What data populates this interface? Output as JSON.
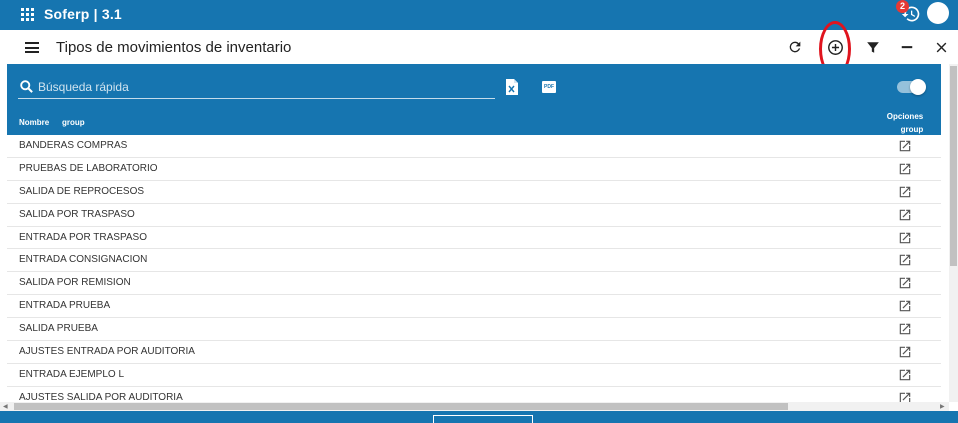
{
  "app": {
    "title": "Soferp | 3.1",
    "notification_count": "2"
  },
  "page": {
    "title": "Tipos de movimientos de inventario"
  },
  "toolbar": {
    "icons": [
      "refresh-icon",
      "add-circle-icon",
      "filter-icon",
      "minimize-icon",
      "close-icon"
    ],
    "highlight_color": "#e0141e"
  },
  "panel": {
    "search_placeholder": "Búsqueda rápida",
    "export_excel_icon": "excel-icon",
    "export_pdf_label": "PDF",
    "toggle_on": true,
    "columns": {
      "nombre": "Nombre",
      "group": "group",
      "opciones": "Opciones",
      "opciones_group": "group"
    },
    "rows": [
      "BANDERAS COMPRAS",
      "PRUEBAS DE LABORATORIO",
      "SALIDA DE REPROCESOS",
      "SALIDA POR TRASPASO",
      "ENTRADA POR TRASPASO",
      "ENTRADA CONSIGNACION",
      "SALIDA POR REMISION",
      "ENTRADA PRUEBA",
      "SALIDA PRUEBA",
      "AJUSTES ENTRADA POR AUDITORIA",
      "ENTRADA EJEMPLO L",
      "AJUSTES SALIDA POR AUDITORIA"
    ]
  },
  "colors": {
    "primary": "#1675b0",
    "row_border": "#e6e6e6",
    "text": "#333333"
  }
}
